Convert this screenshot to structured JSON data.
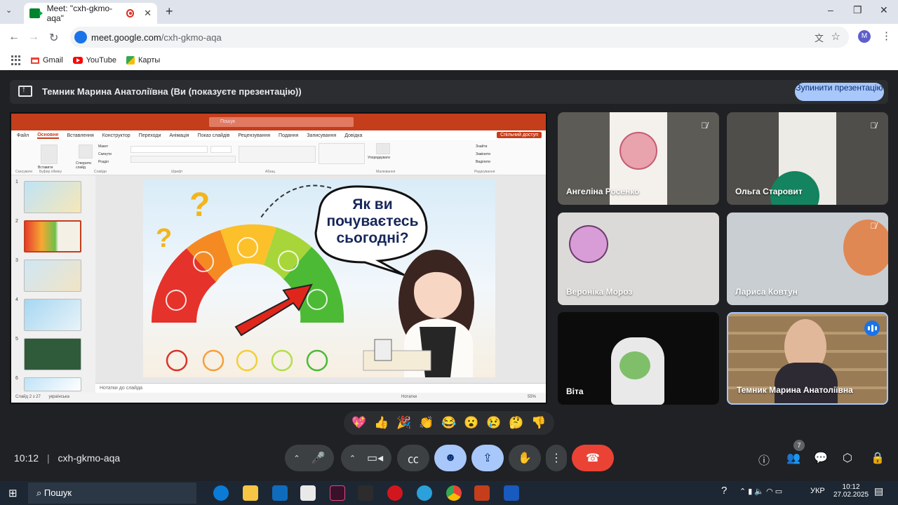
{
  "browser": {
    "tab_title": "Meet: \"cxh-gkmo-aqa\"",
    "tab_close": "✕",
    "new_tab": "+",
    "url_host": "meet.google.com",
    "url_path": "/cxh-gkmo-aqa",
    "avatar_letter": "M",
    "window_controls": [
      "–",
      "❐",
      "✕"
    ],
    "bookmarks": [
      "Gmail",
      "YouTube",
      "Карты"
    ]
  },
  "meet": {
    "presenting_text": "Темник Марина Анатоліївна (Ви (показуєте презентацію))",
    "stop_button": "Зупинити презентацію",
    "meeting_time": "10:12",
    "meeting_code": "cxh-gkmo-aqa",
    "participant_count": "7",
    "reactions": [
      "💖",
      "👍",
      "🎉",
      "👏",
      "😂",
      "😮",
      "😢",
      "🤔",
      "👎"
    ],
    "participants": [
      {
        "name": "Ангеліна Росенко",
        "muted": true
      },
      {
        "name": "Ольга Старовит",
        "muted": true
      },
      {
        "name": "Вероніка Мороз",
        "muted": false
      },
      {
        "name": "Лариса Ковтун",
        "muted": true
      },
      {
        "name": "Віта",
        "muted": false
      },
      {
        "name": "Темник Марина Анатоліївна",
        "muted": false
      }
    ]
  },
  "ppt": {
    "search_placeholder": "Пошук",
    "menu": [
      "Файл",
      "Основне",
      "Вставлення",
      "Конструктор",
      "Переходи",
      "Анімація",
      "Показ слайдів",
      "Рецензування",
      "Подання",
      "Записування",
      "Довідка"
    ],
    "share": "Спільний доступ",
    "ribbon_groups": [
      "Скасувати",
      "Буфер обміну",
      "Слайди",
      "Шрифт",
      "Абзац",
      "Малювання",
      "Редагування"
    ],
    "ribbon_labels": {
      "paste": "Вставити",
      "new_slide": "Створити слайд",
      "arrange": "Упорядкувати",
      "find": "Знайти",
      "replace": "Замінити",
      "select": "Виділити",
      "layout": "Макет",
      "reset": "Скинути",
      "section": "Розділ"
    },
    "thumb_numbers": [
      "1",
      "2",
      "3",
      "4",
      "5",
      "6"
    ],
    "notes": "Нотатки до слайда",
    "status_left": "Слайд 2 з 27",
    "status_lang": "українська",
    "status_notes": "Нотатки",
    "status_zoom": "55%",
    "slide_text": [
      "Як ви",
      "почуваєтесь",
      "сьогодні?"
    ]
  },
  "taskbar": {
    "search": "Пошук",
    "lang": "УКР",
    "time": "10:12",
    "date": "27.02.2025"
  }
}
